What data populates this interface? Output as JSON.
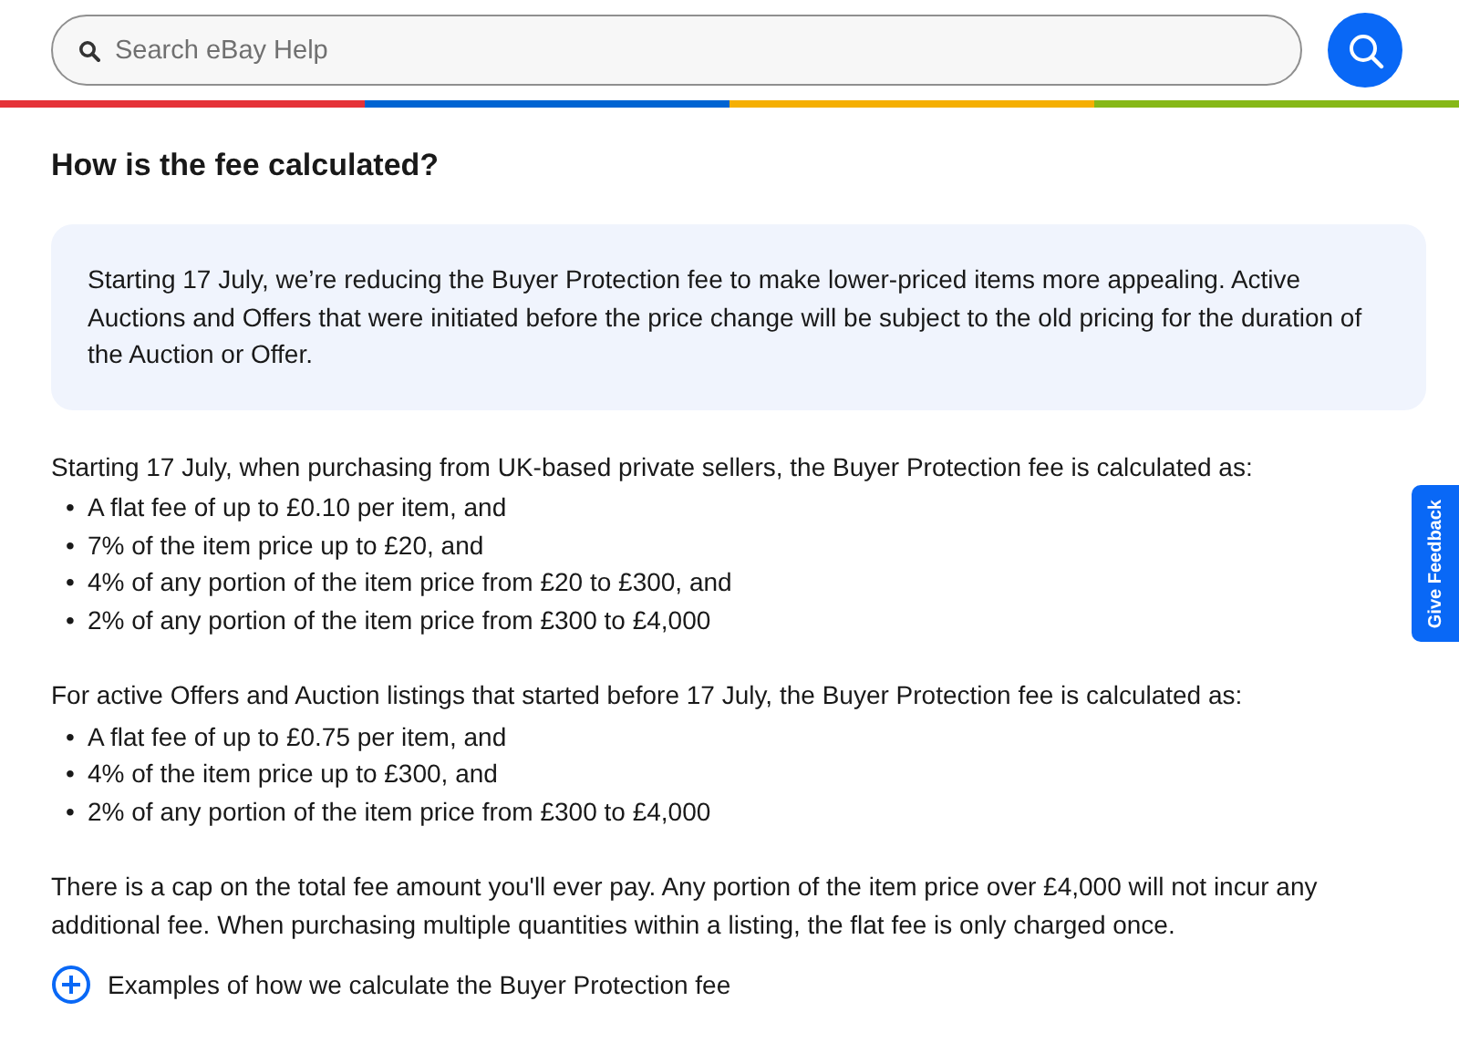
{
  "search": {
    "placeholder": "Search eBay Help"
  },
  "heading": "How is the fee calculated?",
  "notice": "Starting 17 July, we’re reducing the Buyer Protection fee to make lower-priced items more appealing. Active Auctions and Offers that were initiated before the price change will be subject to the old pricing for the duration of the Auction or Offer.",
  "sections": [
    {
      "marker": "•",
      "intro": "Starting 17 July, when purchasing from UK-based private sellers, the Buyer Protection fee is calculated as:",
      "bullets": [
        "A flat fee of up to £0.10 per item, and",
        "7% of the item price up to £20, and",
        "4% of any portion of the item price from £20 to £300, and",
        "2% of any portion of the item price from £300 to £4,000"
      ]
    },
    {
      "marker": "•",
      "intro": "For active Offers and Auction listings that started before 17 July, the Buyer Protection fee is calculated as:",
      "bullets": [
        "A flat fee of up to £0.75 per item, and",
        "4% of the item price up to £300, and",
        "2% of any portion of the item price from £300 to £4,000"
      ]
    }
  ],
  "closing": "There is a cap on the total fee amount you'll ever pay. Any portion of the item price over £4,000 will not incur any additional fee. When purchasing multiple quantities within a listing, the flat fee is only charged once.",
  "expander": {
    "label": "Examples of how we calculate the Buyer Protection fee",
    "expanded": false
  },
  "feedback": "Give Feedback"
}
